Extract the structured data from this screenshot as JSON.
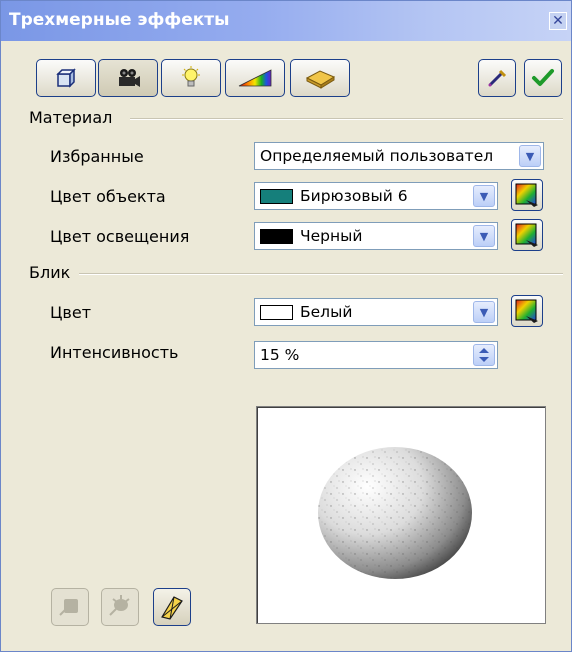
{
  "window": {
    "title": "Трехмерные эффекты",
    "close_glyph": "✕"
  },
  "toolbar": {
    "left_buttons": [
      {
        "name": "geometry-icon"
      },
      {
        "name": "camera-icon"
      },
      {
        "name": "lightbulb-icon"
      },
      {
        "name": "gradient-icon"
      },
      {
        "name": "soap-texture-icon"
      }
    ],
    "right_buttons": [
      {
        "name": "pipette-icon"
      },
      {
        "name": "checkmark-icon"
      }
    ]
  },
  "material": {
    "section_label": "Материал",
    "favorites_label": "Избранные",
    "favorites_value": "Определяемый пользовател",
    "object_color_label": "Цвет объекта",
    "object_color_value": "Бирюзовый 6",
    "object_color_hex": "#157f7b",
    "illumination_color_label": "Цвет освещения",
    "illumination_color_value": "Черный",
    "illumination_color_hex": "#000000"
  },
  "highlight": {
    "section_label": "Блик",
    "color_label": "Цвет",
    "color_value": "Белый",
    "color_hex": "#ffffff",
    "intensity_label": "Интенсивность",
    "intensity_value": "15 %"
  },
  "preview": {
    "shape": "sphere"
  },
  "bottom_buttons": [
    {
      "name": "convert-to-3d-icon",
      "enabled": false
    },
    {
      "name": "convert-to-lathe-icon",
      "enabled": false
    },
    {
      "name": "perspective-toggle-icon",
      "enabled": true
    }
  ]
}
